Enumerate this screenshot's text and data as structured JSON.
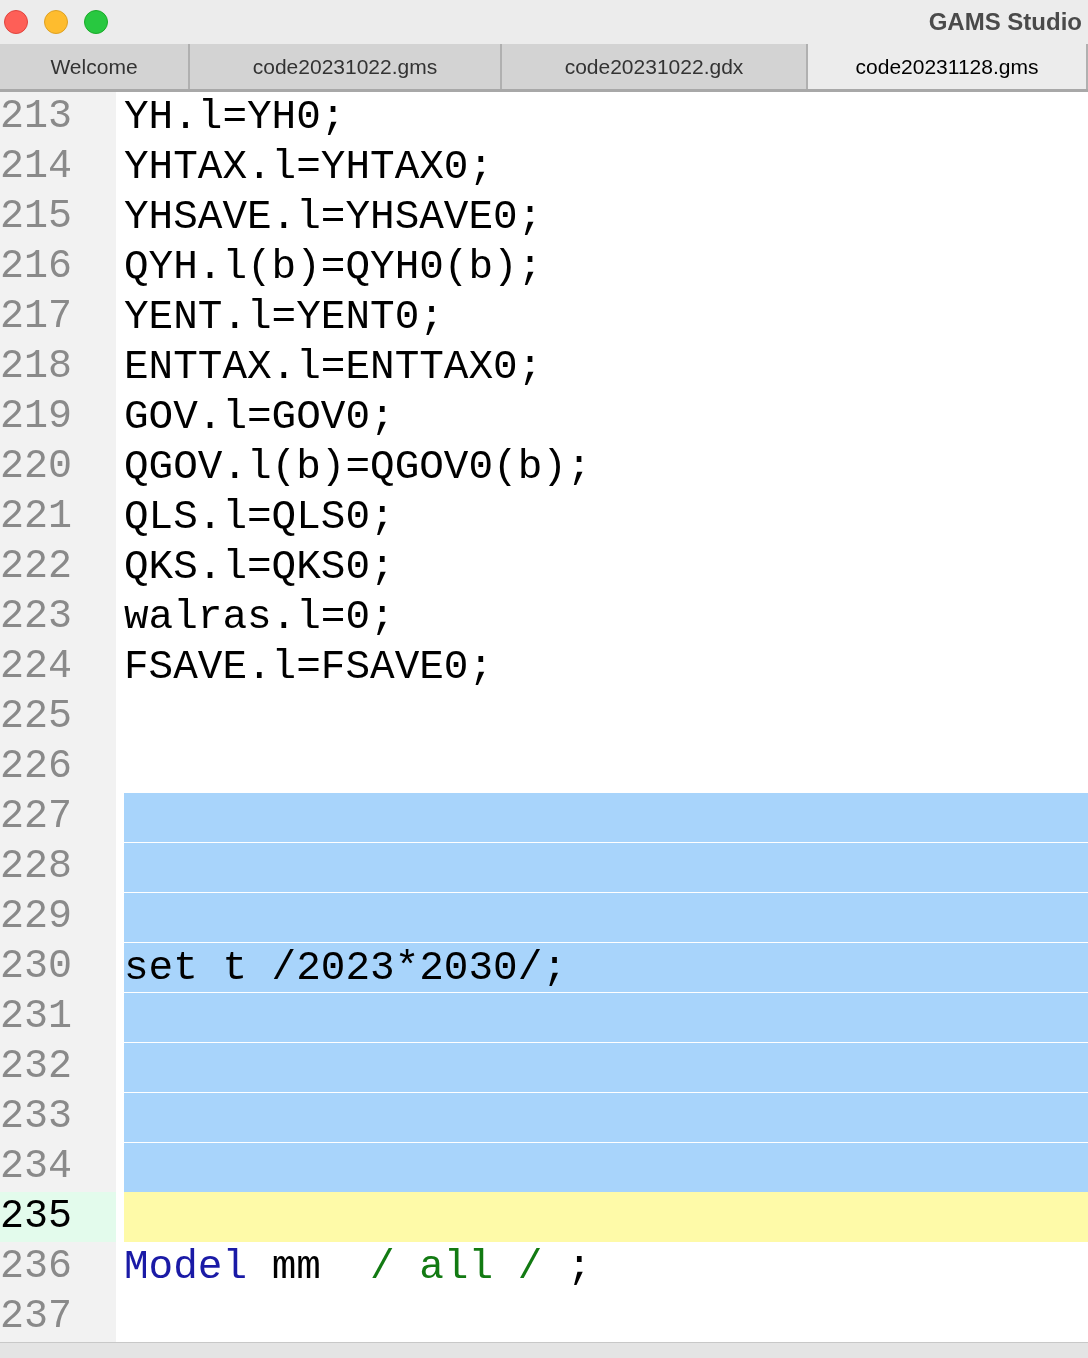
{
  "window": {
    "title": "GAMS Studio"
  },
  "tabs": [
    {
      "label": "Welcome",
      "selected": false
    },
    {
      "label": "code20231022.gms",
      "selected": false
    },
    {
      "label": "code20231022.gdx",
      "selected": false
    },
    {
      "label": "code20231128.gms",
      "selected": true
    }
  ],
  "editor": {
    "lines": [
      {
        "number": "213",
        "segments": [
          {
            "text": "YH.l=YH0;",
            "kind": "plain"
          }
        ],
        "selected": false,
        "current": false
      },
      {
        "number": "214",
        "segments": [
          {
            "text": "YHTAX.l=YHTAX0;",
            "kind": "plain"
          }
        ],
        "selected": false,
        "current": false
      },
      {
        "number": "215",
        "segments": [
          {
            "text": "YHSAVE.l=YHSAVE0;",
            "kind": "plain"
          }
        ],
        "selected": false,
        "current": false
      },
      {
        "number": "216",
        "segments": [
          {
            "text": "QYH.l(b)=QYH0(b);",
            "kind": "plain"
          }
        ],
        "selected": false,
        "current": false
      },
      {
        "number": "217",
        "segments": [
          {
            "text": "YENT.l=YENT0;",
            "kind": "plain"
          }
        ],
        "selected": false,
        "current": false
      },
      {
        "number": "218",
        "segments": [
          {
            "text": "ENTTAX.l=ENTTAX0;",
            "kind": "plain"
          }
        ],
        "selected": false,
        "current": false
      },
      {
        "number": "219",
        "segments": [
          {
            "text": "GOV.l=GOV0;",
            "kind": "plain"
          }
        ],
        "selected": false,
        "current": false
      },
      {
        "number": "220",
        "segments": [
          {
            "text": "QGOV.l(b)=QGOV0(b);",
            "kind": "plain"
          }
        ],
        "selected": false,
        "current": false
      },
      {
        "number": "221",
        "segments": [
          {
            "text": "QLS.l=QLS0;",
            "kind": "plain"
          }
        ],
        "selected": false,
        "current": false
      },
      {
        "number": "222",
        "segments": [
          {
            "text": "QKS.l=QKS0;",
            "kind": "plain"
          }
        ],
        "selected": false,
        "current": false
      },
      {
        "number": "223",
        "segments": [
          {
            "text": "walras.l=0;",
            "kind": "plain"
          }
        ],
        "selected": false,
        "current": false
      },
      {
        "number": "224",
        "segments": [
          {
            "text": "FSAVE.l=FSAVE0;",
            "kind": "plain"
          }
        ],
        "selected": false,
        "current": false
      },
      {
        "number": "225",
        "selected": false,
        "current": false
      },
      {
        "number": "226",
        "selected": false,
        "current": false
      },
      {
        "number": "227",
        "selected": true,
        "current": false
      },
      {
        "number": "228",
        "selected": true,
        "current": false
      },
      {
        "number": "229",
        "selected": true,
        "current": false
      },
      {
        "number": "230",
        "segments": [
          {
            "text": "set t /2023*2030/;",
            "kind": "plain"
          }
        ],
        "selected": true,
        "current": false
      },
      {
        "number": "231",
        "selected": true,
        "current": false
      },
      {
        "number": "232",
        "selected": true,
        "current": false
      },
      {
        "number": "233",
        "selected": true,
        "current": false
      },
      {
        "number": "234",
        "selected": true,
        "current": false
      },
      {
        "number": "235",
        "selected": false,
        "current": true
      },
      {
        "number": "236",
        "segments": [
          {
            "text": "Model",
            "kind": "keyword"
          },
          {
            "text": " mm  ",
            "kind": "plain"
          },
          {
            "text": "/ all /",
            "kind": "set"
          },
          {
            "text": " ;",
            "kind": "plain"
          }
        ],
        "selected": false,
        "current": false
      },
      {
        "number": "237",
        "selected": false,
        "current": false
      }
    ]
  }
}
